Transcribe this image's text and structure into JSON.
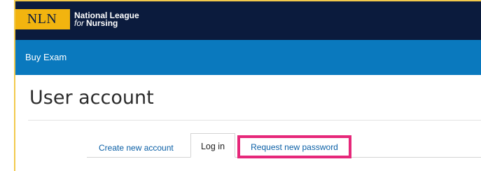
{
  "header": {
    "logo_mark": "NLN",
    "logo_line1": "National League",
    "logo_line2_prefix": "for",
    "logo_line2_main": "Nursing"
  },
  "nav": {
    "items": [
      {
        "label": "Buy Exam"
      }
    ]
  },
  "page": {
    "title": "User account"
  },
  "tabs": [
    {
      "label": "Create new account",
      "active": false
    },
    {
      "label": "Log in",
      "active": true
    },
    {
      "label": "Request new password",
      "active": false,
      "highlighted": true
    }
  ],
  "colors": {
    "header_bg": "#0b1b3d",
    "logo_bg": "#f2b40f",
    "nav_bg": "#0a79be",
    "link": "#0a5fa6",
    "highlight": "#e6287a",
    "frame_border": "#f2c94c"
  }
}
